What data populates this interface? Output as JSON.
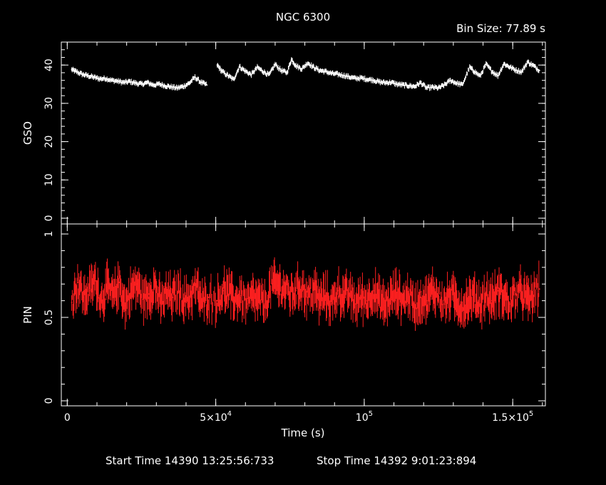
{
  "chart_data": {
    "type": "line",
    "title": "NGC 6300",
    "bin_size": "Bin Size: 77.89 s",
    "xlabel": "Time (s)",
    "xlim": [
      -2000,
      161000
    ],
    "x_ticks": [
      {
        "value": 0,
        "label": "0"
      },
      {
        "value": 50000,
        "label": "5×10",
        "exp": "4"
      },
      {
        "value": 100000,
        "label": "10",
        "exp": "5"
      },
      {
        "value": 150000,
        "label": "1.5×10",
        "exp": "5"
      }
    ],
    "footer": {
      "start": "Start Time 14390 13:25:56:733",
      "stop": "Stop Time 14392  9:01:23:894"
    },
    "panels": [
      {
        "ylabel": "GSO",
        "ylim": [
          -1.5,
          46
        ],
        "y_ticks": [
          0,
          10,
          20,
          30,
          40
        ],
        "color": "#ffffff",
        "series": [
          {
            "name": "",
            "points": [
              [
                1500,
                38.8
              ],
              [
                3000,
                38.3
              ],
              [
                5000,
                37.6
              ],
              [
                7000,
                37.2
              ],
              [
                9000,
                36.8
              ],
              [
                11000,
                36.4
              ],
              [
                13000,
                36.5
              ],
              [
                15000,
                36.0
              ],
              [
                17000,
                35.8
              ],
              [
                19000,
                35.4
              ],
              [
                21000,
                35.7
              ],
              [
                23000,
                35.3
              ],
              [
                25000,
                35.0
              ],
              [
                27000,
                35.4
              ],
              [
                29000,
                34.8
              ],
              [
                31000,
                35.0
              ],
              [
                33000,
                34.6
              ],
              [
                35000,
                34.3
              ],
              [
                37000,
                34.0
              ],
              [
                39000,
                34.4
              ],
              [
                41000,
                35.2
              ],
              [
                43000,
                36.8
              ],
              [
                45000,
                35.5
              ],
              [
                47000,
                34.8
              ],
              [
                50500,
                40.0
              ],
              [
                52000,
                38.4
              ],
              [
                54000,
                37.3
              ],
              [
                56000,
                36.2
              ],
              [
                58000,
                39.6
              ],
              [
                60000,
                38.4
              ],
              [
                62000,
                37.5
              ],
              [
                64000,
                39.4
              ],
              [
                66000,
                38.3
              ],
              [
                68000,
                37.4
              ],
              [
                70000,
                40.2
              ],
              [
                72000,
                38.6
              ],
              [
                74000,
                38.0
              ],
              [
                75500,
                41.5
              ],
              [
                77000,
                39.8
              ],
              [
                79000,
                39.0
              ],
              [
                81000,
                40.6
              ],
              [
                83000,
                39.4
              ],
              [
                85000,
                38.6
              ],
              [
                87000,
                38.3
              ],
              [
                89000,
                37.8
              ],
              [
                91000,
                37.6
              ],
              [
                93000,
                37.3
              ],
              [
                95000,
                36.9
              ],
              [
                97000,
                36.5
              ],
              [
                99000,
                36.6
              ],
              [
                101000,
                36.3
              ],
              [
                103000,
                36.1
              ],
              [
                105000,
                35.6
              ],
              [
                107000,
                35.4
              ],
              [
                109000,
                35.5
              ],
              [
                111000,
                35.0
              ],
              [
                113000,
                34.8
              ],
              [
                115000,
                34.6
              ],
              [
                117000,
                34.4
              ],
              [
                119000,
                35.4
              ],
              [
                121000,
                34.0
              ],
              [
                123000,
                34.2
              ],
              [
                125000,
                34.0
              ],
              [
                127000,
                34.8
              ],
              [
                129000,
                36.0
              ],
              [
                131000,
                35.3
              ],
              [
                133000,
                34.8
              ],
              [
                135500,
                39.4
              ],
              [
                137000,
                38.4
              ],
              [
                139000,
                37.1
              ],
              [
                141000,
                40.2
              ],
              [
                143000,
                38.4
              ],
              [
                145000,
                37.2
              ],
              [
                147000,
                40.3
              ],
              [
                149000,
                39.5
              ],
              [
                151000,
                38.7
              ],
              [
                153000,
                38.2
              ],
              [
                155000,
                40.8
              ],
              [
                157000,
                39.8
              ],
              [
                159000,
                38.6
              ]
            ]
          }
        ]
      },
      {
        "ylabel": "PIN",
        "ylim": [
          -0.03,
          1.06
        ],
        "y_ticks": [
          0,
          0.5,
          1
        ],
        "y_tick_labels": [
          "0",
          "0.5",
          "1"
        ],
        "color": "#ff2020",
        "series": [
          {
            "name": "",
            "points": [
              [
                1500,
                0.59
              ],
              [
                3500,
                0.71
              ],
              [
                5500,
                0.62
              ],
              [
                7500,
                0.66
              ],
              [
                9500,
                0.72
              ],
              [
                11500,
                0.6
              ],
              [
                13500,
                0.68
              ],
              [
                15500,
                0.62
              ],
              [
                17500,
                0.71
              ],
              [
                19500,
                0.57
              ],
              [
                21500,
                0.66
              ],
              [
                23500,
                0.7
              ],
              [
                25500,
                0.61
              ],
              [
                27500,
                0.64
              ],
              [
                29500,
                0.69
              ],
              [
                31500,
                0.58
              ],
              [
                33500,
                0.64
              ],
              [
                35500,
                0.62
              ],
              [
                37500,
                0.66
              ],
              [
                39500,
                0.6
              ],
              [
                41500,
                0.63
              ],
              [
                43500,
                0.68
              ],
              [
                45500,
                0.58
              ],
              [
                47500,
                0.62
              ],
              [
                50500,
                0.6
              ],
              [
                52500,
                0.66
              ],
              [
                54500,
                0.64
              ],
              [
                56500,
                0.6
              ],
              [
                58500,
                0.63
              ],
              [
                60500,
                0.58
              ],
              [
                62500,
                0.62
              ],
              [
                64500,
                0.6
              ],
              [
                66500,
                0.58
              ],
              [
                69000,
                0.7
              ],
              [
                71000,
                0.69
              ],
              [
                73000,
                0.67
              ],
              [
                75000,
                0.64
              ],
              [
                77000,
                0.66
              ],
              [
                79000,
                0.69
              ],
              [
                81000,
                0.62
              ],
              [
                83000,
                0.67
              ],
              [
                85000,
                0.6
              ],
              [
                87000,
                0.63
              ],
              [
                89000,
                0.58
              ],
              [
                91000,
                0.66
              ],
              [
                93000,
                0.62
              ],
              [
                95000,
                0.64
              ],
              [
                97000,
                0.58
              ],
              [
                99000,
                0.62
              ],
              [
                101000,
                0.6
              ],
              [
                103000,
                0.66
              ],
              [
                105000,
                0.6
              ],
              [
                107000,
                0.57
              ],
              [
                109000,
                0.62
              ],
              [
                111000,
                0.65
              ],
              [
                113000,
                0.6
              ],
              [
                115000,
                0.64
              ],
              [
                117000,
                0.56
              ],
              [
                119000,
                0.62
              ],
              [
                121000,
                0.6
              ],
              [
                123000,
                0.66
              ],
              [
                125000,
                0.63
              ],
              [
                127000,
                0.58
              ],
              [
                129000,
                0.64
              ],
              [
                131000,
                0.6
              ],
              [
                133000,
                0.56
              ],
              [
                135000,
                0.6
              ],
              [
                137000,
                0.62
              ],
              [
                139000,
                0.58
              ],
              [
                141000,
                0.63
              ],
              [
                143000,
                0.6
              ],
              [
                145000,
                0.66
              ],
              [
                147000,
                0.63
              ],
              [
                149000,
                0.58
              ],
              [
                151000,
                0.64
              ],
              [
                153000,
                0.65
              ],
              [
                155000,
                0.6
              ],
              [
                157000,
                0.63
              ],
              [
                159000,
                0.67
              ]
            ]
          }
        ]
      }
    ]
  }
}
